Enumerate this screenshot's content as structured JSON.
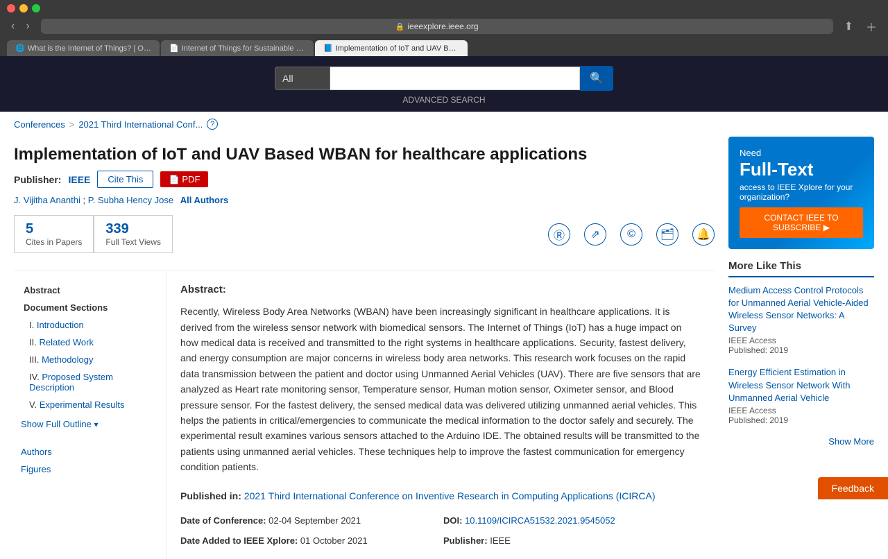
{
  "browser": {
    "url": "ieeexplore.ieee.org",
    "tabs": [
      {
        "id": "tab1",
        "label": "What is the Internet of Things? | Oracle Canada",
        "active": false,
        "icon": "🌐"
      },
      {
        "id": "tab2",
        "label": "Internet of Things for Sustainable Human Health | SpringerLink",
        "active": false,
        "icon": "📄"
      },
      {
        "id": "tab3",
        "label": "Implementation of IoT and UAV Based WBAN for healthcare applications | IEEE Conference Publication...",
        "active": true,
        "icon": "📘"
      }
    ]
  },
  "search": {
    "select_default": "All",
    "placeholder": "",
    "advanced_label": "ADVANCED SEARCH"
  },
  "breadcrumb": {
    "conferences": "Conferences",
    "separator": ">",
    "conference": "2021 Third International Conf..."
  },
  "article": {
    "title": "Implementation of IoT and UAV Based WBAN for healthcare applications",
    "publisher_label": "Publisher:",
    "publisher_name": "IEEE",
    "cite_btn": "Cite This",
    "pdf_btn": "PDF",
    "authors": [
      {
        "name": "J. Vijitha Ananthi",
        "separator": ";"
      },
      {
        "name": "P. Subha Hency Jose",
        "separator": ""
      }
    ],
    "all_authors": "All Authors",
    "cites": "5",
    "cites_label": "Cites in Papers",
    "views": "339",
    "views_label": "Full Text Views",
    "abstract_heading": "Abstract:",
    "abstract_text": "Recently, Wireless Body Area Networks (WBAN) have been increasingly significant in healthcare applications. It is derived from the wireless sensor network with biomedical sensors. The Internet of Things (IoT) has a huge impact on how medical data is received and transmitted to the right systems in healthcare applications. Security, fastest delivery, and energy consumption are major concerns in wireless body area networks. This research work focuses on the rapid data transmission between the patient and doctor using Unmanned Aerial Vehicles (UAV). There are five sensors that are analyzed as Heart rate monitoring sensor, Temperature sensor, Human motion sensor, Oximeter sensor, and Blood pressure sensor. For the fastest delivery, the sensed medical data was delivered utilizing unmanned aerial vehicles. This helps the patients in critical/emergencies to communicate the medical information to the doctor safely and securely. The experimental result examines various sensors attached to the Arduino IDE. The obtained results will be transmitted to the patients using unmanned aerial vehicles. These techniques help to improve the fastest communication for emergency condition patients.",
    "published_in_label": "Published in:",
    "published_in_text": "2021 Third International Conference on Inventive Research in Computing Applications (ICIRCA)",
    "date_of_conference_label": "Date of Conference:",
    "date_of_conference": "02-04 September 2021",
    "doi_label": "DOI:",
    "doi": "10.1109/ICIRCA51532.2021.9545052",
    "date_added_label": "Date Added to IEEE Xplore:",
    "date_added": "01 October 2021",
    "publisher_label2": "Publisher:",
    "publisher_value": "IEEE"
  },
  "toc": {
    "abstract_label": "Abstract",
    "document_sections": "Document Sections",
    "items": [
      {
        "num": "I.",
        "label": "Introduction"
      },
      {
        "num": "II.",
        "label": "Related Work"
      },
      {
        "num": "III.",
        "label": "Methodology"
      },
      {
        "num": "IV.",
        "label": "Proposed System Description"
      },
      {
        "num": "V.",
        "label": "Experimental Results"
      }
    ],
    "show_full": "Show Full Outline",
    "authors": "Authors",
    "figures": "Figures"
  },
  "sidebar": {
    "ad": {
      "need": "Need",
      "full_text_line1": "Full-Text",
      "sub": "access to IEEE Xplore for your organization?",
      "cta": "CONTACT IEEE TO SUBSCRIBE ▶"
    },
    "more_like_title": "More Like This",
    "articles": [
      {
        "title": "Medium Access Control Protocols for Unmanned Aerial Vehicle-Aided Wireless Sensor Networks: A Survey",
        "source": "IEEE Access",
        "published": "Published: 2019"
      },
      {
        "title": "Energy Efficient Estimation in Wireless Sensor Network With Unmanned Aerial Vehicle",
        "source": "IEEE Access",
        "published": "Published: 2019"
      }
    ],
    "show_more": "Show More"
  },
  "feedback": "Feedback"
}
